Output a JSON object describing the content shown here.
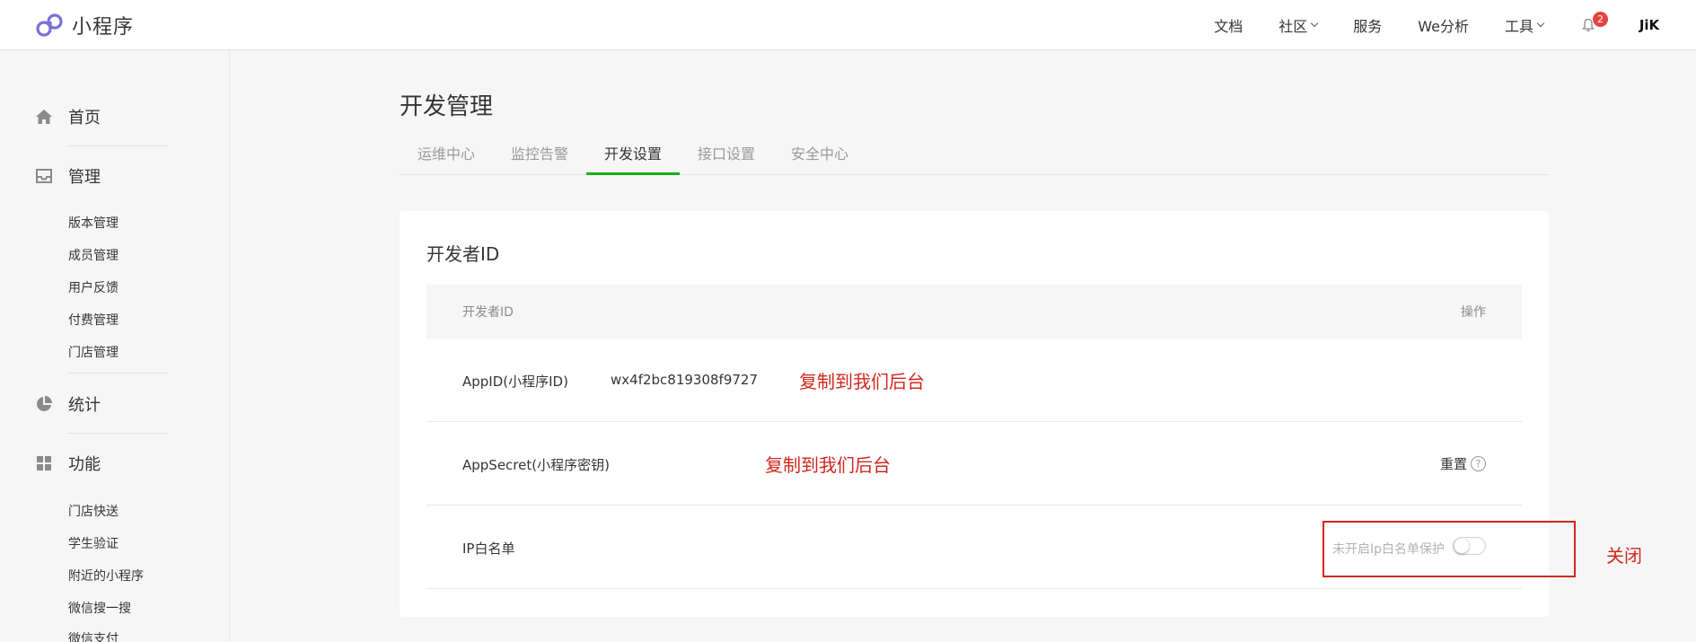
{
  "header": {
    "brand_name": "小程序",
    "nav": {
      "docs": "文档",
      "community": "社区",
      "services": "服务",
      "analytics": "We分析",
      "tools": "工具"
    },
    "notification_count": "2",
    "avatar_text": "JiK"
  },
  "sidebar": {
    "home": "首页",
    "manage": "管理",
    "manage_items": [
      "版本管理",
      "成员管理",
      "用户反馈",
      "付费管理",
      "门店管理"
    ],
    "stats": "统计",
    "features": "功能",
    "feature_items": [
      "门店快送",
      "学生验证",
      "附近的小程序",
      "微信搜一搜",
      "微信支付"
    ]
  },
  "main": {
    "title": "开发管理",
    "tabs": [
      "运维中心",
      "监控告警",
      "开发设置",
      "接口设置",
      "安全中心"
    ],
    "active_tab": "开发设置"
  },
  "card": {
    "title": "开发者ID",
    "columns": {
      "id": "开发者ID",
      "action": "操作"
    },
    "rows": {
      "appid": {
        "label": "AppID(小程序ID)",
        "value": "wx4f2bc819308f9727",
        "annotation": "复制到我们后台"
      },
      "secret": {
        "label": "AppSecret(小程序密钥)",
        "annotation": "复制到我们后台",
        "action": "重置",
        "help": "?"
      },
      "ip": {
        "label": "IP白名单",
        "status": "未开启Ip白名单保护",
        "toggle_on": false
      }
    }
  },
  "annotations": {
    "close": "关闭"
  },
  "colors": {
    "accent": "#1aad19",
    "annotation": "#d1281d",
    "badge": "#e64340"
  }
}
